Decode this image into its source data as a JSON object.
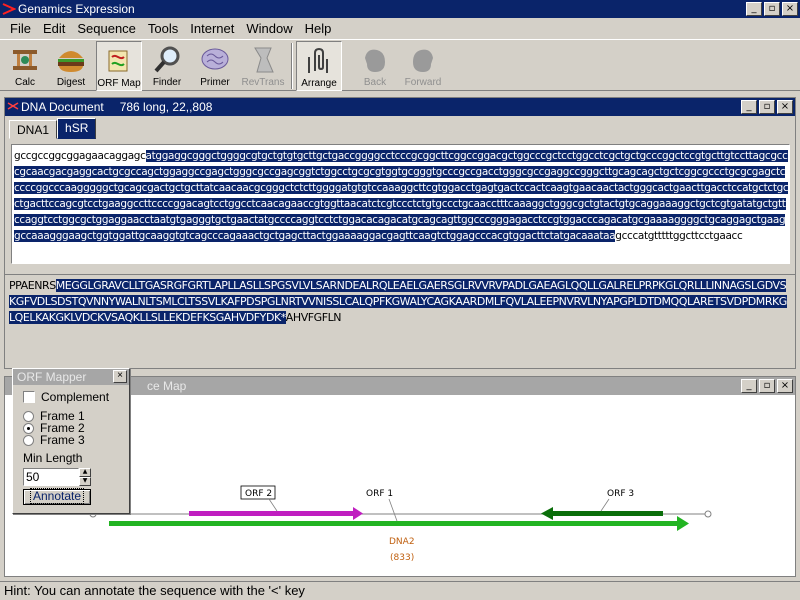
{
  "app": {
    "title": "Genamics Expression",
    "min": "_",
    "max": "▫",
    "close": "×"
  },
  "menu": [
    "File",
    "Edit",
    "Sequence",
    "Tools",
    "Internet",
    "Window",
    "Help"
  ],
  "toolbar": {
    "calc": "Calc",
    "digest": "Digest",
    "orfmap": "ORF Map",
    "finder": "Finder",
    "primer": "Primer",
    "revtrans": "RevTrans",
    "arrange": "Arrange",
    "back": "Back",
    "forward": "Forward"
  },
  "dna_doc": {
    "title": "DNA Document",
    "info": "786 long, 22,,808",
    "tabs": [
      "DNA1",
      "hSR"
    ],
    "seq_plain_start": "gccgccggcggagaacaggagc",
    "seq_selected": "atggaggcgggctggggcgtgctgtgtgcttgctgaccggggcctcccgcggcttcggccggacgctggcccgctcctggcctcgctgctgcccggctccgtgcttgtccttagcgcccgcaacgacgaggcactgcgccagctggaggccgagctgggcgccgagcggtctggcctgcgcgtggtgcgggtgcccgccgacctgggcgccgaggccgggcttgcagcagctgctcggcgccctgcgcgagctcccccggcccaagggggctgcagcgactgctgcttatcaacaacgcgggctctcttggggatgtgtccaaaggcttcgtggacctgagtgactccactcaagtgaacaactactgggcactgaacttgacctccatgctctgcctgacttccagcgtcctgaaggccttccccggacagtcctggcctcaacagaaccgtggttaacatctcgtccctctgtgccctgcaacctttcaaaggctgggcgctgtactgtgcaggaaaggctgctcgtgatatgctgttccaggtcctggcgctggaggaacctaatgtgagggtgctgaactatgccccaggtcctctggacacagacatgcagcagttggcccgggagacctccgtggacccagacatgcgaaaaggggctgcaggagctgaaggccaaagggaagctggtggattgcaaggtgtcagcccagaaactgctgagcttactggaaaaggacgagttcaagtctggagcccacgtggacttctatgacaaataa",
    "seq_plain_end": "gcccatgtttttggcttcctgaacc",
    "prot_plain_start": "PPAENRS",
    "prot_selected": "MEGGLGRAVCLLTGASRGFGRTLAPLLASLLSPGSVLVLSARNDEALRQLEAELGAERSGLRVVRVPADLGAEAGLQQLLGALRELPRPKGLQRLLLINNAGSLGDVSKGFVDLSDSTQVNNYWALNLTSMLCLTSSVLKAFPDSPGLNRTVVNISSLCALQPFKGWALYCAGKAARDMLFQVLALEEPNVRVLNYAPGPLDTDMQQLARETSVDPDMRKGLQELKAKGKLVDCKVSAQKLLSLLEKDEFKSGAHVDFYDK*",
    "prot_plain_end": "AHVFGFLN"
  },
  "seq_map": {
    "title_visible": "ce Map",
    "labels": {
      "orf1": "ORF 1",
      "orf2": "ORF 2",
      "orf3": "ORF 3",
      "dna": "DNA2",
      "length": "(833)"
    },
    "colors": {
      "orf1": "#22b422",
      "orf2": "#c01ec0",
      "orf3": "#0a6e0a",
      "dna": "#c06010"
    }
  },
  "orf_mapper": {
    "title": "ORF Mapper",
    "complement": "Complement",
    "frame1": "Frame 1",
    "frame2": "Frame 2",
    "frame3": "Frame 3",
    "min_length_label": "Min Length",
    "min_length_value": "50",
    "annotate": "Annotate"
  },
  "status": {
    "hint": "Hint: You can annotate the sequence with the '<' key"
  }
}
